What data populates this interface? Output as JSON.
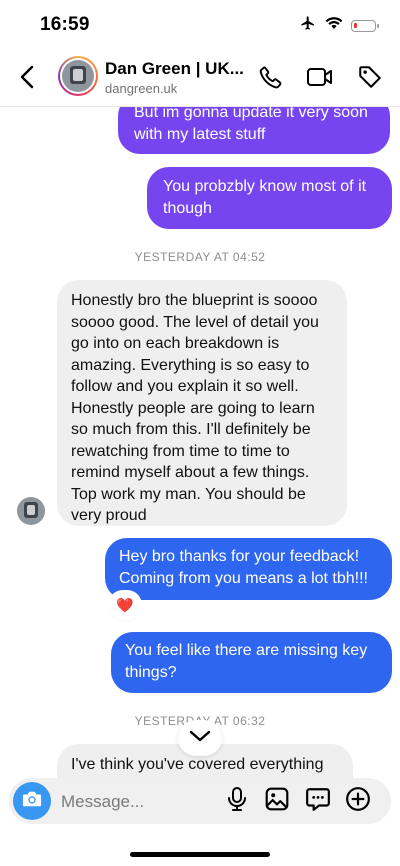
{
  "status": {
    "time": "16:59",
    "battery_level": 0.15
  },
  "header": {
    "name": "Dan Green | UK...",
    "handle": "dangreen.uk"
  },
  "messages": [
    {
      "direction": "out",
      "color": "#7745f0",
      "text": "But im gonna update it very soon with my latest stuff"
    },
    {
      "direction": "out",
      "color": "#7745f0",
      "text": "You probzbly know most of it though"
    },
    {
      "type": "timestamp",
      "text": "YESTERDAY AT 04:52"
    },
    {
      "direction": "in",
      "text": "Honestly bro the blueprint is soooo soooo good. The level of detail you go into on each breakdown is amazing. Everything is so easy to follow and you explain it so well. Honestly people are going to learn so much from this. I'll definitely be rewatching from time to time to remind myself about a few things. Top work my man. You should be very proud"
    },
    {
      "direction": "out",
      "color": "#2f66ef",
      "text": "Hey bro thanks for your feedback! Coming from you means a lot tbh!!!",
      "reaction": "❤️"
    },
    {
      "direction": "out",
      "color": "#2f66ef",
      "text": "You feel like there are missing key things?"
    },
    {
      "type": "timestamp",
      "text": "YESTERDAY AT 06:32"
    },
    {
      "direction": "in",
      "text": "I've think you've covered everything"
    }
  ],
  "composer": {
    "placeholder": "Message..."
  },
  "icons": {
    "back": "chevron-left-icon",
    "call": "phone-icon",
    "video": "video-camera-icon",
    "tag": "tag-icon",
    "camera": "camera-icon",
    "mic": "microphone-icon",
    "gallery": "image-icon",
    "sticker": "sticker-icon",
    "add": "plus-circle-icon",
    "scroll": "chevron-down-icon"
  }
}
